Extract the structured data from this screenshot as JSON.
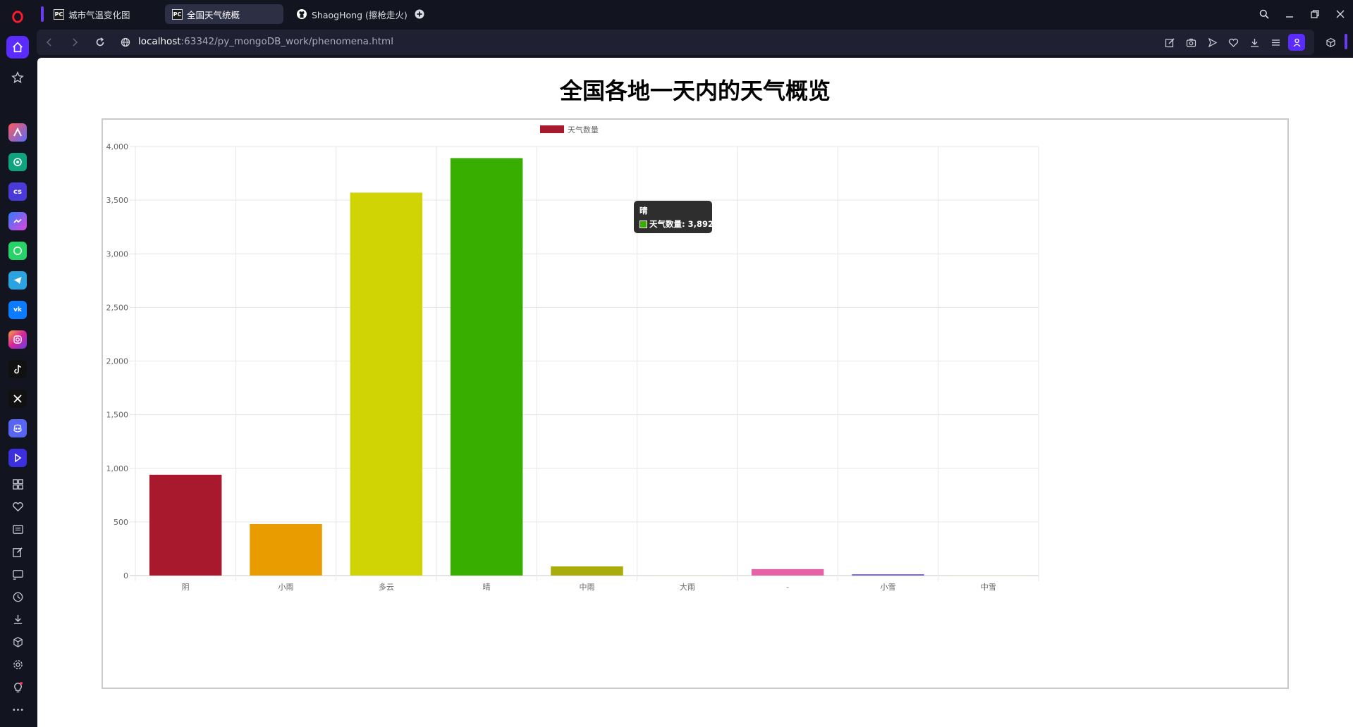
{
  "browser": {
    "tabs": [
      {
        "label": "城市气温变化图",
        "favicon": "PC",
        "active": false
      },
      {
        "label": "全国天气统概",
        "favicon": "PC",
        "active": true
      },
      {
        "label": "ShaogHong (擦枪走火)",
        "favicon": "github-icon",
        "active": false
      }
    ],
    "url_host": "localhost",
    "url_rest": ":63342/py_mongoDB_work/phenomena.html",
    "accent": "#6b3cf0"
  },
  "sidebar": {
    "apps": [
      "aria-icon",
      "chatgpt-icon",
      "cs-icon",
      "messenger-icon",
      "whatsapp-icon",
      "telegram-icon",
      "vk-icon",
      "instagram-icon",
      "tiktok-icon",
      "x-icon",
      "discord-icon",
      "player-icon"
    ],
    "cs_label": "cs"
  },
  "page": {
    "title": "全国各地一天内的天气概览"
  },
  "tooltip": {
    "title": "晴",
    "text": "天气数量: 3,892",
    "color": "#38ae00"
  },
  "chart_data": {
    "type": "bar",
    "categories": [
      "阴",
      "小雨",
      "多云",
      "晴",
      "中雨",
      "大雨",
      "-",
      "小雪",
      "中雪"
    ],
    "series": [
      {
        "name": "天气数量",
        "values": [
          940,
          480,
          3570,
          3892,
          85,
          3,
          60,
          12,
          3
        ],
        "colors": [
          "#a8192e",
          "#e89c00",
          "#d0d404",
          "#38ae00",
          "#a9ac09",
          "#d0cfa8",
          "#e761a6",
          "#6d5bd6",
          "#cfcfb0"
        ]
      }
    ],
    "y_ticks": [
      "0",
      "500",
      "1,000",
      "1,500",
      "2,000",
      "2,500",
      "3,000",
      "3,500",
      "4,000"
    ],
    "ylim": [
      0,
      4000
    ],
    "grid": true,
    "legend": "top-center",
    "legend_color": "#a8192e"
  }
}
